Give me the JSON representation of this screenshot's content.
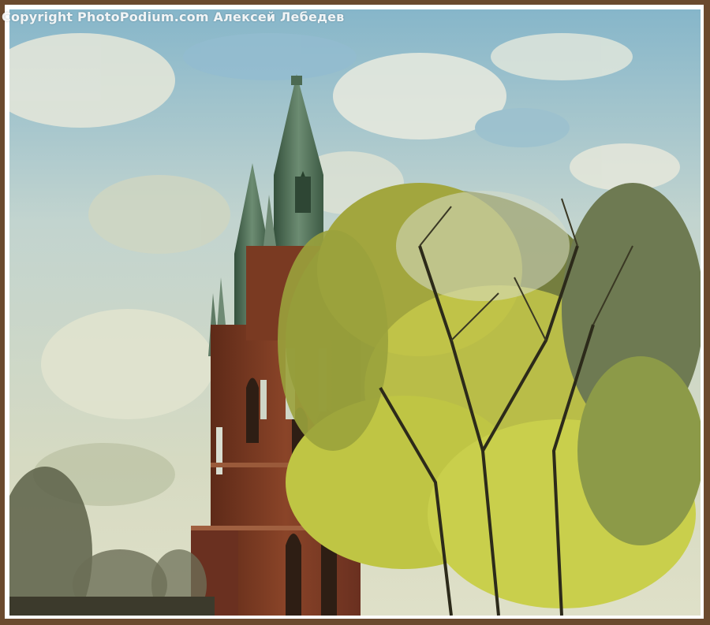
{
  "watermark": {
    "text": "Copyright PhotoPodium.com Алексей Лебедев"
  },
  "scene": {
    "subject": "church-tower-icon",
    "colors": {
      "sky_top": "#7fb2c9",
      "sky_mid": "#c9d7cf",
      "sky_bottom": "#d9dcc4",
      "brick": "#7a3a22",
      "roof": "#4a6a4e",
      "foliage_light": "#c6c84a",
      "foliage_dark": "#5c6a2a",
      "frame": "#6b4a2e"
    }
  }
}
